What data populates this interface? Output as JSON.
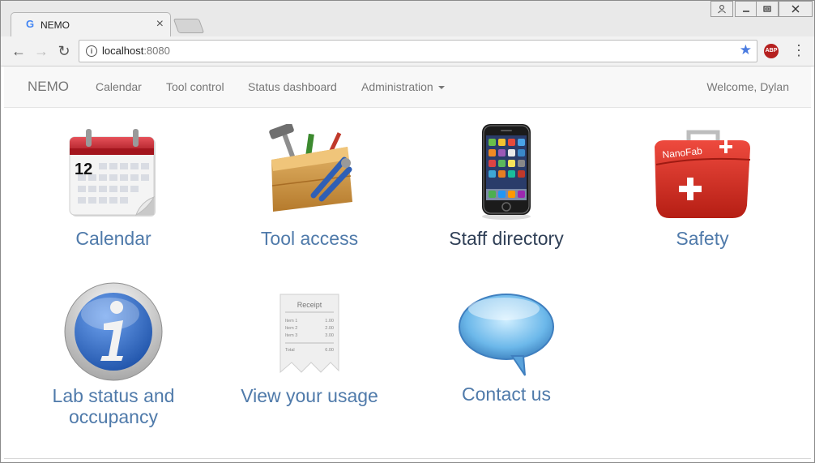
{
  "browser": {
    "tab_title": "NEMO",
    "tab_favicon": "G",
    "url_host": "localhost",
    "url_port": ":8080",
    "abp_label": "ABP"
  },
  "navbar": {
    "brand": "NEMO",
    "links": [
      "Calendar",
      "Tool control",
      "Status dashboard",
      "Administration"
    ],
    "welcome": "Welcome, Dylan"
  },
  "tiles": [
    {
      "label": "Calendar",
      "icon": "calendar-icon",
      "calendar_day": "12"
    },
    {
      "label": "Tool access",
      "icon": "toolbox-icon"
    },
    {
      "label": "Staff directory",
      "icon": "phone-icon"
    },
    {
      "label": "Safety",
      "icon": "first-aid-kit-icon",
      "kit_text": "NanoFab"
    },
    {
      "label_line1": "Lab status and",
      "label_line2": "occupancy",
      "icon": "info-icon"
    },
    {
      "label": "View your usage",
      "icon": "receipt-icon",
      "receipt": {
        "title": "Receipt",
        "rows": [
          [
            "Item 1",
            "1.00"
          ],
          [
            "Item 2",
            "2.00"
          ],
          [
            "Item 3",
            "3.00"
          ]
        ],
        "total_label": "Total",
        "total_value": "6.00"
      }
    },
    {
      "label": "Contact us",
      "icon": "speech-bubble-icon"
    }
  ]
}
